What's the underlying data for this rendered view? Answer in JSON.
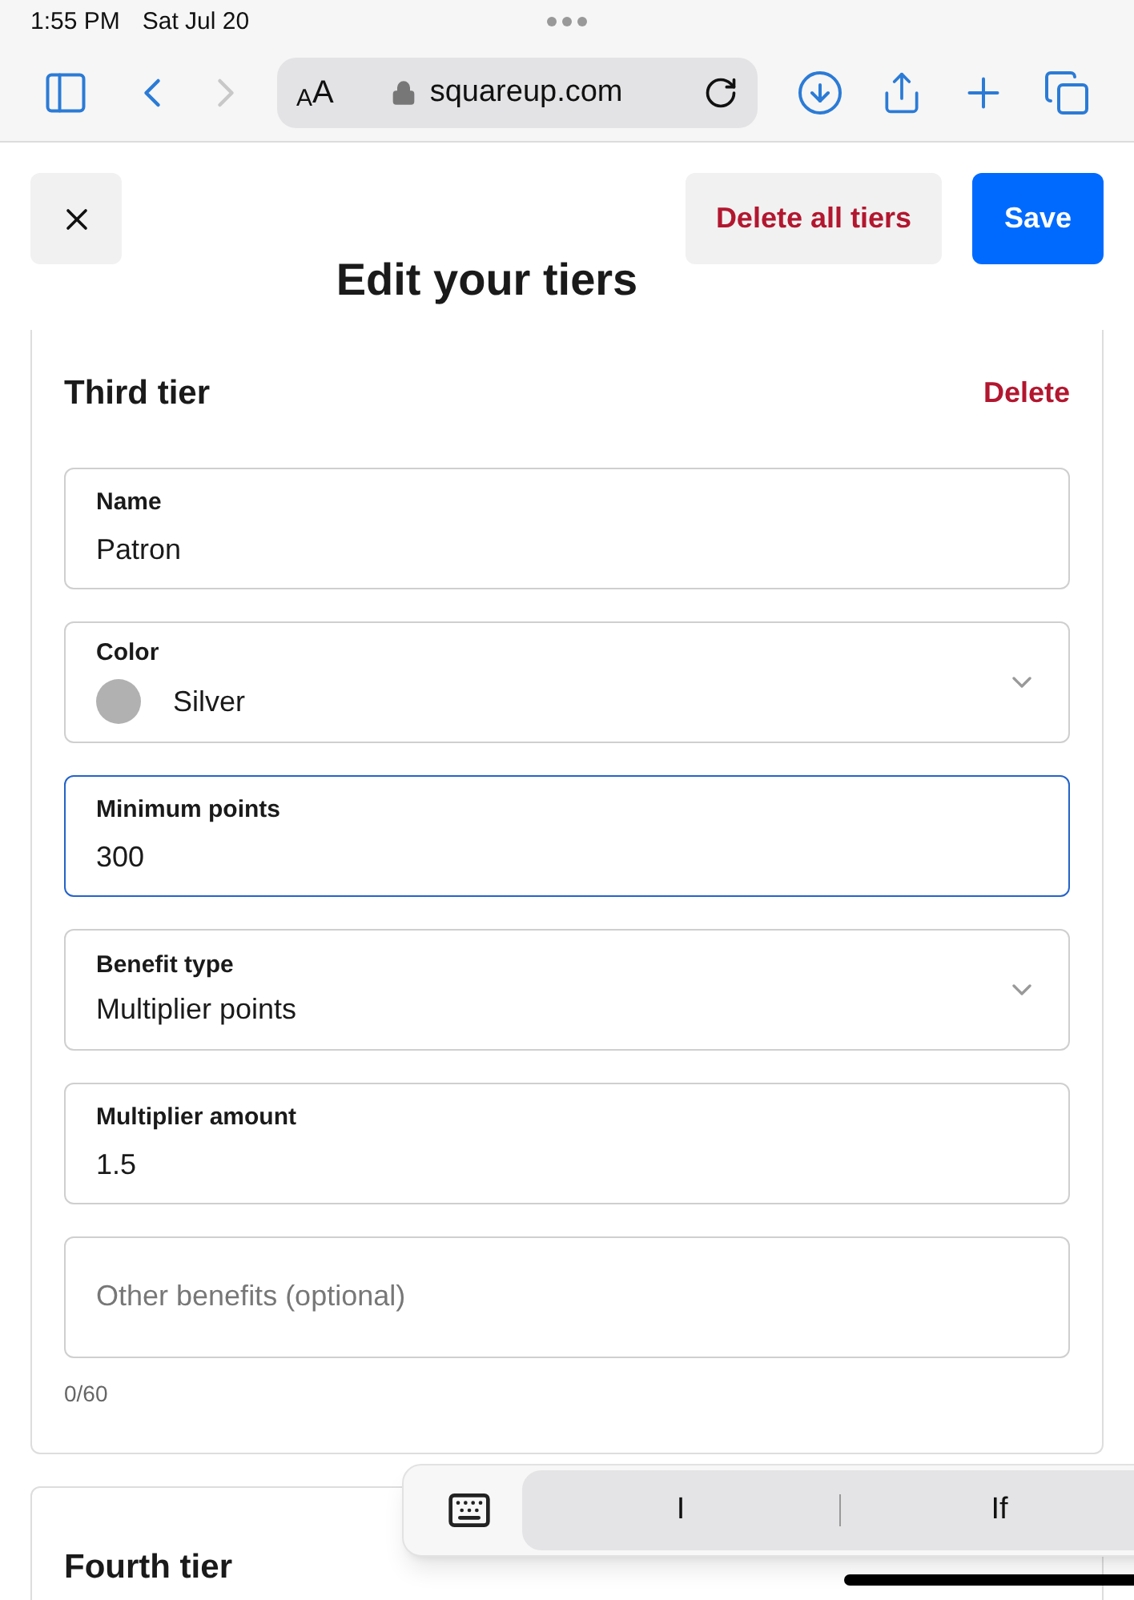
{
  "status_bar": {
    "time": "1:55 PM",
    "date": "Sat Jul 20"
  },
  "browser": {
    "format_button": "AA",
    "url": "squareup.com",
    "forward_disabled": true
  },
  "header": {
    "title": "Edit your tiers",
    "delete_all": "Delete all tiers",
    "save": "Save"
  },
  "tiers": [
    {
      "title": "Third tier",
      "delete": "Delete",
      "fields": [
        {
          "kind": "text",
          "label": "Name",
          "value": "Patron",
          "focused": false
        },
        {
          "kind": "select",
          "label": "Color",
          "value": "Silver",
          "color": "#b1b1b1"
        },
        {
          "kind": "text",
          "label": "Minimum points",
          "value": "300",
          "focused": true
        },
        {
          "kind": "select",
          "label": "Benefit type",
          "value": "Multiplier points"
        },
        {
          "kind": "text",
          "label": "Multiplier amount",
          "value": "1.5",
          "focused": false
        },
        {
          "kind": "textarea",
          "placeholder": "Other benefits (optional)"
        }
      ],
      "counter": "0/60"
    },
    {
      "title": "Fourth tier"
    }
  ],
  "keyboard_bar": {
    "suggestions": [
      "I",
      "If"
    ]
  }
}
